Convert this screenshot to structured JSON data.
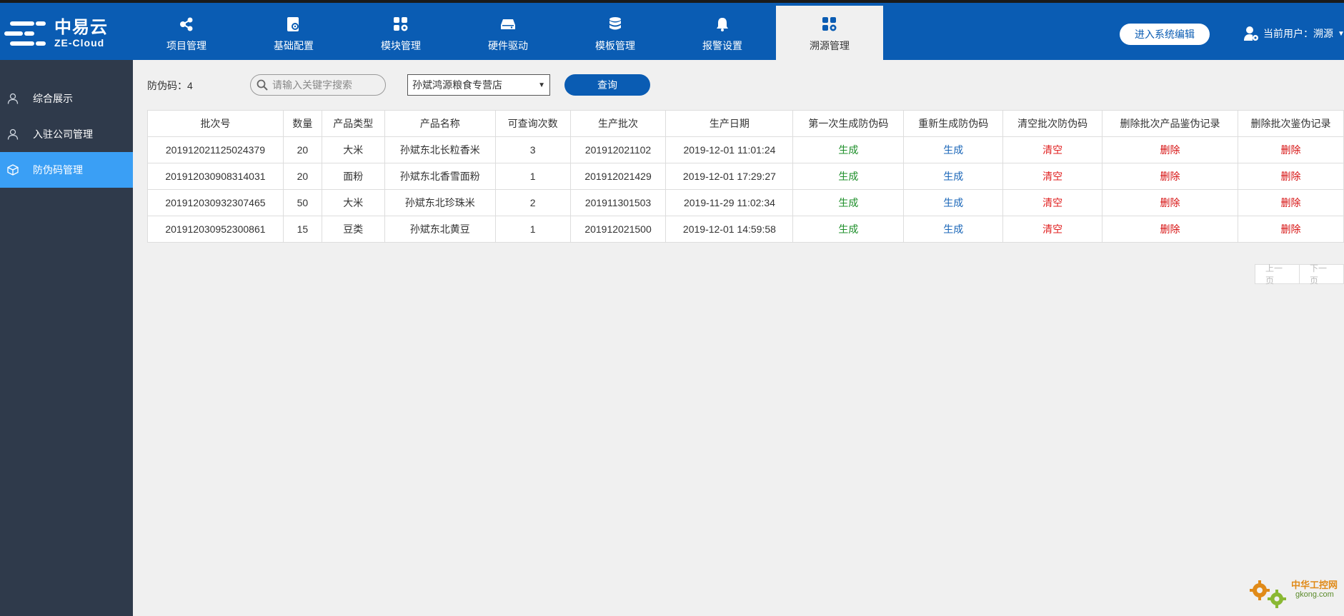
{
  "logo": {
    "cn": "中易云",
    "en": "ZE-Cloud"
  },
  "nav": [
    {
      "label": "项目管理",
      "icon": "share-nodes-icon"
    },
    {
      "label": "基础配置",
      "icon": "document-gear-icon"
    },
    {
      "label": "模块管理",
      "icon": "grid-gear-icon"
    },
    {
      "label": "硬件驱动",
      "icon": "hard-drive-icon"
    },
    {
      "label": "模板管理",
      "icon": "database-icon"
    },
    {
      "label": "报警设置",
      "icon": "bell-icon"
    },
    {
      "label": "溯源管理",
      "icon": "grid-gear-icon",
      "active": true
    }
  ],
  "header": {
    "edit_button": "进入系统编辑",
    "user_label": "当前用户：溯源"
  },
  "sidebar": {
    "items": [
      {
        "label": "综合展示",
        "icon": "user-icon"
      },
      {
        "label": "入驻公司管理",
        "icon": "user-icon"
      },
      {
        "label": "防伪码管理",
        "icon": "cube-icon",
        "active": true
      }
    ]
  },
  "toolbar": {
    "count_label": "防伪码：4",
    "search_placeholder": "请输入关键字搜索",
    "store_select": "孙斌鸿源粮食专营店",
    "query_button": "查询"
  },
  "table": {
    "headers": [
      "批次号",
      "数量",
      "产品类型",
      "产品名称",
      "可查询次数",
      "生产批次",
      "生产日期",
      "第一次生成防伪码",
      "重新生成防伪码",
      "清空批次防伪码",
      "删除批次产品鉴伪记录",
      "删除批次鉴伪记录"
    ],
    "rows": [
      {
        "batch": "201912021125024379",
        "qty": "20",
        "type": "大米",
        "name": "孙斌东北长粒香米",
        "queries": "3",
        "prod_batch": "201912021102",
        "date": "2019-12-01 11:01:24",
        "gen": "生成",
        "regen": "生成",
        "clear": "清空",
        "del_product": "删除",
        "del_batch": "删除"
      },
      {
        "batch": "201912030908314031",
        "qty": "20",
        "type": "面粉",
        "name": "孙斌东北香雪面粉",
        "queries": "1",
        "prod_batch": "201912021429",
        "date": "2019-12-01 17:29:27",
        "gen": "生成",
        "regen": "生成",
        "clear": "清空",
        "del_product": "删除",
        "del_batch": "删除"
      },
      {
        "batch": "201912030932307465",
        "qty": "50",
        "type": "大米",
        "name": "孙斌东北珍珠米",
        "queries": "2",
        "prod_batch": "201911301503",
        "date": "2019-11-29 11:02:34",
        "gen": "生成",
        "regen": "生成",
        "clear": "清空",
        "del_product": "删除",
        "del_batch": "删除"
      },
      {
        "batch": "201912030952300861",
        "qty": "15",
        "type": "豆类",
        "name": "孙斌东北黄豆",
        "queries": "1",
        "prod_batch": "201912021500",
        "date": "2019-12-01 14:59:58",
        "gen": "生成",
        "regen": "生成",
        "clear": "清空",
        "del_product": "删除",
        "del_batch": "删除"
      }
    ]
  },
  "pagination": {
    "prev": "上一页",
    "next": "下一页"
  },
  "watermark": {
    "text": "中华工控网",
    "url": "gkong.com"
  },
  "colors": {
    "header_bg": "#0a5cb3",
    "sidebar_bg": "#2f3a4b",
    "sidebar_active": "#3a9ff5",
    "generate": "#1e8f2a",
    "regenerate": "#1a66b8",
    "clear": "#e02020",
    "delete": "#d61010"
  }
}
